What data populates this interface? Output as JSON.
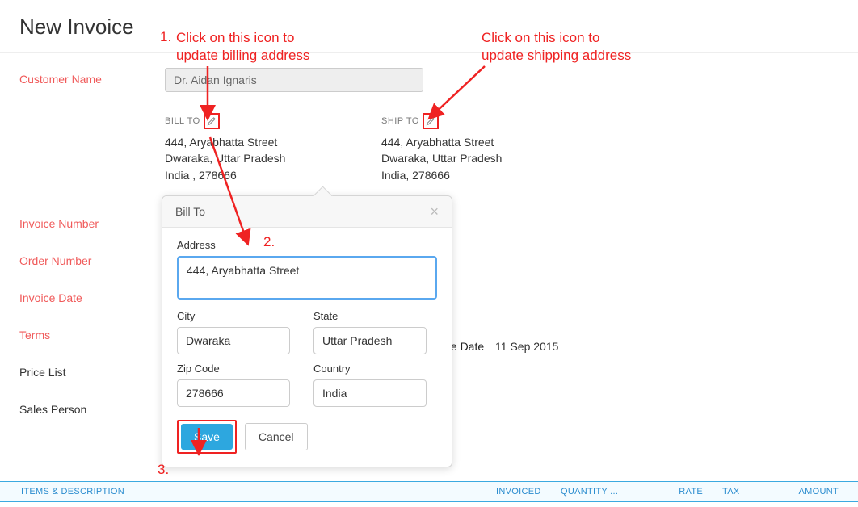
{
  "page_title": "New Invoice",
  "customer": {
    "label": "Customer Name",
    "value": "Dr. Aidan Ignaris"
  },
  "bill_to": {
    "heading": "BILL TO",
    "line1": "444, Aryabhatta Street",
    "line2": "Dwaraka, Uttar Pradesh",
    "line3": "India , 278666"
  },
  "ship_to": {
    "heading": "SHIP TO",
    "line1": "444, Aryabhatta Street",
    "line2": "Dwaraka, Uttar Pradesh",
    "line3": "India, 278666"
  },
  "labels": {
    "invoice_number": "Invoice Number",
    "order_number": "Order Number",
    "invoice_date": "Invoice Date",
    "terms": "Terms",
    "price_list": "Price List",
    "sales_person": "Sales Person",
    "due_date": "Due Date"
  },
  "due_date_value": "11 Sep 2015",
  "popover": {
    "title": "Bill To",
    "address_label": "Address",
    "address_value": "444, Aryabhatta Street",
    "city_label": "City",
    "city_value": "Dwaraka",
    "state_label": "State",
    "state_value": "Uttar Pradesh",
    "zip_label": "Zip Code",
    "zip_value": "278666",
    "country_label": "Country",
    "country_value": "India",
    "save_label": "Save",
    "cancel_label": "Cancel"
  },
  "table": {
    "items": "ITEMS & DESCRIPTION",
    "invoiced": "INVOICED",
    "quantity": "QUANTITY ...",
    "rate": "RATE",
    "tax": "TAX",
    "amount": "AMOUNT"
  },
  "annotations": {
    "step1": "1.",
    "step1_text": "Click on this icon to\nupdate billing address",
    "step2": "2.",
    "step3": "3.",
    "ship_text": "Click on this icon to\nupdate shipping address"
  }
}
